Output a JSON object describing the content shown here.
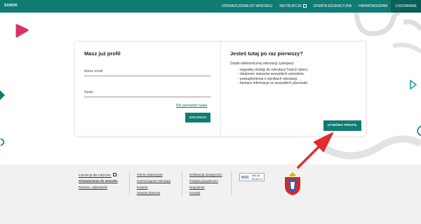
{
  "header": {
    "brand": "SANOK",
    "nav": [
      {
        "label": "OŚWIADCZENIA DO WNIOSKU"
      },
      {
        "label": "INSTRUKCJA"
      },
      {
        "label": "OFERTA EDUKACYJNA"
      },
      {
        "label": "HARMONOGRAM"
      },
      {
        "label": "LOGOWANIE"
      }
    ]
  },
  "login": {
    "title": "Masz już profil",
    "email_label": "Adres email",
    "password_label": "Hasło",
    "forgot_link": "Nie pamiętam hasła",
    "login_button": "ZALOGUJ"
  },
  "register": {
    "title": "Jesteś tutaj po raz pierwszy?",
    "intro": "Dzięki elektronicznej rekrutacji zyskujesz:",
    "benefits": [
      "wygodny dostęp do rekrutacji Twoich dzieci,",
      "śledzenie statusów wszystkich wniosków,",
      "powiadomienia o wynikach rekrutacji,",
      "bieżące informacje ze wszystkich placówek."
    ],
    "create_button": "UTWÓRZ PROFIL"
  },
  "footer": {
    "col1": [
      "Instrukcja dla rodziców",
      "Oświadczenia do wniosku",
      "Pytania i odpowiedzi"
    ],
    "col2": [
      "Oferta edukacyjna",
      "Harmonogram rekrutacji",
      "Kryteria",
      "Zespoły klasowe"
    ],
    "col3": [
      "Deklaracja dostępności",
      "Polityka prywatności",
      "Regulamin",
      "Kontakt"
    ],
    "badge": {
      "w3c": "W3C",
      "line1": "WAI-AA",
      "line2": "WCAG 2.1"
    }
  },
  "colors": {
    "primary": "#0f7c73",
    "arrow": "#e32b2b",
    "accent_pink": "#d6336c"
  }
}
